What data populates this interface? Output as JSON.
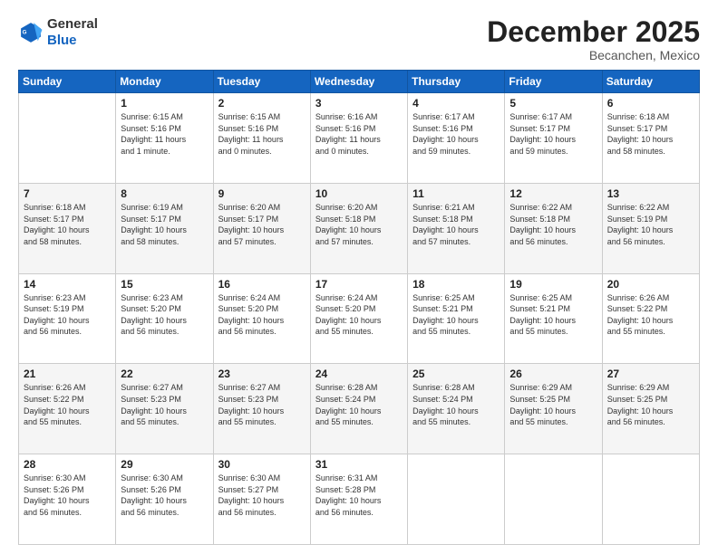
{
  "logo": {
    "line1": "General",
    "line2": "Blue"
  },
  "header": {
    "month": "December 2025",
    "location": "Becanchen, Mexico"
  },
  "days_of_week": [
    "Sunday",
    "Monday",
    "Tuesday",
    "Wednesday",
    "Thursday",
    "Friday",
    "Saturday"
  ],
  "weeks": [
    [
      {
        "day": "",
        "info": ""
      },
      {
        "day": "1",
        "info": "Sunrise: 6:15 AM\nSunset: 5:16 PM\nDaylight: 11 hours\nand 1 minute."
      },
      {
        "day": "2",
        "info": "Sunrise: 6:15 AM\nSunset: 5:16 PM\nDaylight: 11 hours\nand 0 minutes."
      },
      {
        "day": "3",
        "info": "Sunrise: 6:16 AM\nSunset: 5:16 PM\nDaylight: 11 hours\nand 0 minutes."
      },
      {
        "day": "4",
        "info": "Sunrise: 6:17 AM\nSunset: 5:16 PM\nDaylight: 10 hours\nand 59 minutes."
      },
      {
        "day": "5",
        "info": "Sunrise: 6:17 AM\nSunset: 5:17 PM\nDaylight: 10 hours\nand 59 minutes."
      },
      {
        "day": "6",
        "info": "Sunrise: 6:18 AM\nSunset: 5:17 PM\nDaylight: 10 hours\nand 58 minutes."
      }
    ],
    [
      {
        "day": "7",
        "info": "Sunrise: 6:18 AM\nSunset: 5:17 PM\nDaylight: 10 hours\nand 58 minutes."
      },
      {
        "day": "8",
        "info": "Sunrise: 6:19 AM\nSunset: 5:17 PM\nDaylight: 10 hours\nand 58 minutes."
      },
      {
        "day": "9",
        "info": "Sunrise: 6:20 AM\nSunset: 5:17 PM\nDaylight: 10 hours\nand 57 minutes."
      },
      {
        "day": "10",
        "info": "Sunrise: 6:20 AM\nSunset: 5:18 PM\nDaylight: 10 hours\nand 57 minutes."
      },
      {
        "day": "11",
        "info": "Sunrise: 6:21 AM\nSunset: 5:18 PM\nDaylight: 10 hours\nand 57 minutes."
      },
      {
        "day": "12",
        "info": "Sunrise: 6:22 AM\nSunset: 5:18 PM\nDaylight: 10 hours\nand 56 minutes."
      },
      {
        "day": "13",
        "info": "Sunrise: 6:22 AM\nSunset: 5:19 PM\nDaylight: 10 hours\nand 56 minutes."
      }
    ],
    [
      {
        "day": "14",
        "info": "Sunrise: 6:23 AM\nSunset: 5:19 PM\nDaylight: 10 hours\nand 56 minutes."
      },
      {
        "day": "15",
        "info": "Sunrise: 6:23 AM\nSunset: 5:20 PM\nDaylight: 10 hours\nand 56 minutes."
      },
      {
        "day": "16",
        "info": "Sunrise: 6:24 AM\nSunset: 5:20 PM\nDaylight: 10 hours\nand 56 minutes."
      },
      {
        "day": "17",
        "info": "Sunrise: 6:24 AM\nSunset: 5:20 PM\nDaylight: 10 hours\nand 55 minutes."
      },
      {
        "day": "18",
        "info": "Sunrise: 6:25 AM\nSunset: 5:21 PM\nDaylight: 10 hours\nand 55 minutes."
      },
      {
        "day": "19",
        "info": "Sunrise: 6:25 AM\nSunset: 5:21 PM\nDaylight: 10 hours\nand 55 minutes."
      },
      {
        "day": "20",
        "info": "Sunrise: 6:26 AM\nSunset: 5:22 PM\nDaylight: 10 hours\nand 55 minutes."
      }
    ],
    [
      {
        "day": "21",
        "info": "Sunrise: 6:26 AM\nSunset: 5:22 PM\nDaylight: 10 hours\nand 55 minutes."
      },
      {
        "day": "22",
        "info": "Sunrise: 6:27 AM\nSunset: 5:23 PM\nDaylight: 10 hours\nand 55 minutes."
      },
      {
        "day": "23",
        "info": "Sunrise: 6:27 AM\nSunset: 5:23 PM\nDaylight: 10 hours\nand 55 minutes."
      },
      {
        "day": "24",
        "info": "Sunrise: 6:28 AM\nSunset: 5:24 PM\nDaylight: 10 hours\nand 55 minutes."
      },
      {
        "day": "25",
        "info": "Sunrise: 6:28 AM\nSunset: 5:24 PM\nDaylight: 10 hours\nand 55 minutes."
      },
      {
        "day": "26",
        "info": "Sunrise: 6:29 AM\nSunset: 5:25 PM\nDaylight: 10 hours\nand 55 minutes."
      },
      {
        "day": "27",
        "info": "Sunrise: 6:29 AM\nSunset: 5:25 PM\nDaylight: 10 hours\nand 56 minutes."
      }
    ],
    [
      {
        "day": "28",
        "info": "Sunrise: 6:30 AM\nSunset: 5:26 PM\nDaylight: 10 hours\nand 56 minutes."
      },
      {
        "day": "29",
        "info": "Sunrise: 6:30 AM\nSunset: 5:26 PM\nDaylight: 10 hours\nand 56 minutes."
      },
      {
        "day": "30",
        "info": "Sunrise: 6:30 AM\nSunset: 5:27 PM\nDaylight: 10 hours\nand 56 minutes."
      },
      {
        "day": "31",
        "info": "Sunrise: 6:31 AM\nSunset: 5:28 PM\nDaylight: 10 hours\nand 56 minutes."
      },
      {
        "day": "",
        "info": ""
      },
      {
        "day": "",
        "info": ""
      },
      {
        "day": "",
        "info": ""
      }
    ]
  ]
}
